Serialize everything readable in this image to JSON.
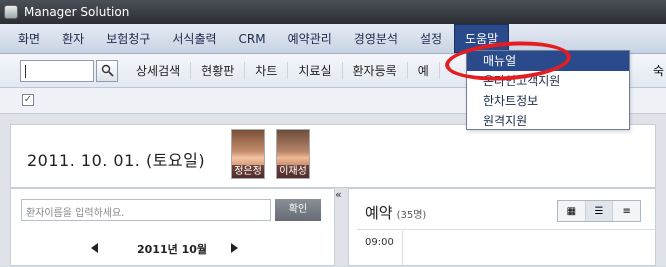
{
  "window": {
    "title": "Manager Solution"
  },
  "menubar": {
    "items": [
      "화면",
      "환자",
      "보험청구",
      "서식출력",
      "CRM",
      "예약관리",
      "경영분석",
      "설정",
      "도움말"
    ]
  },
  "toolbar": {
    "items": [
      "상세검색",
      "현황판",
      "차트",
      "치료실",
      "환자등록",
      "예"
    ],
    "end_label": "숙"
  },
  "dropdown": {
    "items": [
      "매뉴얼",
      "온라인고객지원",
      "한차트정보",
      "원격지원"
    ]
  },
  "status": {
    "checkbox": "✓"
  },
  "summary": {
    "date": "2011. 10. 01. (토요일)",
    "staff": [
      "정은정",
      "이재성"
    ]
  },
  "patient": {
    "placeholder": "환자이름을 입력하세요.",
    "confirm_label": "확인",
    "month": "2011년 10월"
  },
  "collapse": {
    "label": "«"
  },
  "reservation": {
    "title": "예약",
    "count": "(35명)",
    "first_time": "09:00",
    "view_icons": [
      "▦",
      "☰",
      "≡"
    ]
  },
  "colors": {
    "accent": "#2b4a8b",
    "highlight": "#e51d21"
  }
}
